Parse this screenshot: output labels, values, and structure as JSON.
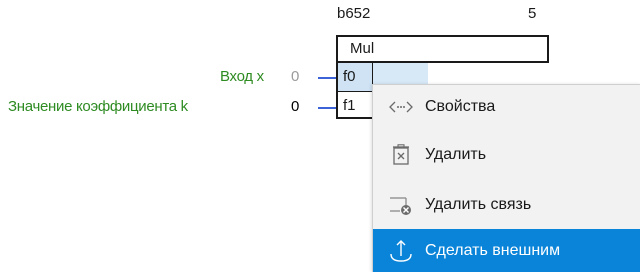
{
  "block": {
    "id": "b652",
    "number": "5",
    "type": "Mul",
    "ports": [
      {
        "name": "f0"
      },
      {
        "name": "f1"
      }
    ]
  },
  "inputs": [
    {
      "label": "Вход x",
      "value": "0",
      "value_color": "#9a9a9a"
    },
    {
      "label": "Значение коэффициента k",
      "value": "0",
      "value_color": "#000000"
    }
  ],
  "context_menu": {
    "items": [
      {
        "label": "Свойства",
        "icon": "properties-icon"
      },
      {
        "label": "Удалить",
        "icon": "delete-icon"
      },
      {
        "label": "Удалить связь",
        "icon": "remove-link-icon"
      },
      {
        "label": "Сделать внешним",
        "icon": "make-external-icon",
        "highlighted": true
      }
    ]
  },
  "colors": {
    "label_green": "#2e8b22",
    "wire_blue": "#3c64d8",
    "menu_highlight": "#0a84d9",
    "port_selected": "#cfe3f5"
  }
}
